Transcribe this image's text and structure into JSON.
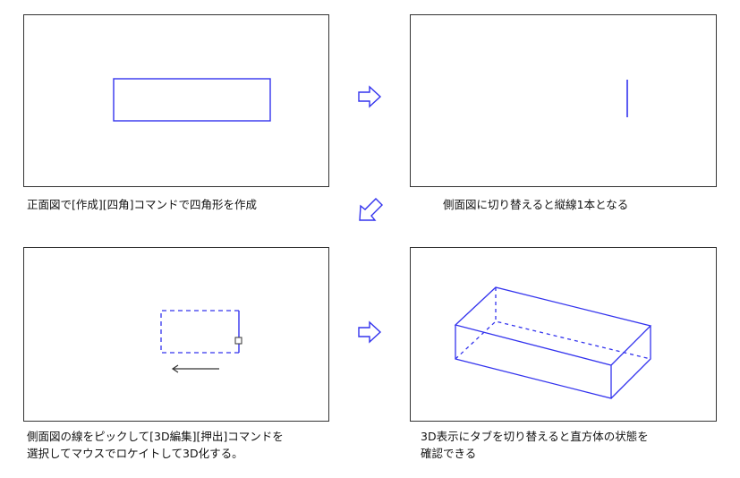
{
  "captions": {
    "step1": "正面図で[作成][四角]コマンドで四角形を作成",
    "step2": "側面図に切り替えると縦線1本となる",
    "step3_line1": "側面図の線をピックして[3D編集][押出]コマンドを",
    "step3_line2": "選択してマウスでロケイトして3D化する。",
    "step4_line1": "3D表示にタブを切り替えると直方体の状態を",
    "step4_line2": "確認できる"
  },
  "colors": {
    "shape": "#3333ee",
    "frame": "#333333",
    "arrow": "#3333ee",
    "locate_arrow": "#333333"
  },
  "icons": {
    "flow_right": "hollow-right-arrow",
    "flow_diagonal": "hollow-down-left-arrow"
  }
}
